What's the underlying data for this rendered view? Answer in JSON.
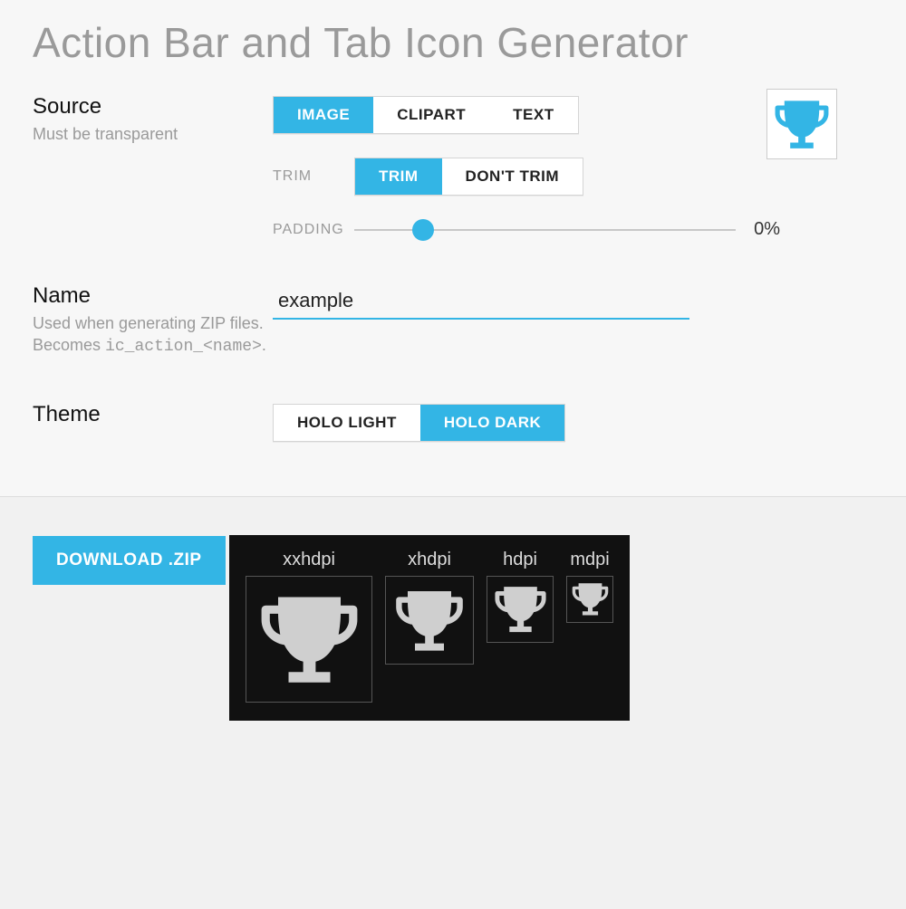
{
  "page": {
    "title": "Action Bar and Tab Icon Generator"
  },
  "source": {
    "label": "Source",
    "sub": "Must be transparent",
    "tabs": {
      "image": "IMAGE",
      "clipart": "CLIPART",
      "text": "TEXT"
    },
    "active": "image",
    "trim": {
      "label": "TRIM",
      "options": {
        "trim": "TRIM",
        "dont_trim": "DON'T TRIM"
      },
      "active": "trim"
    },
    "padding": {
      "label": "PADDING",
      "value_pct": 0,
      "display": "0%",
      "slider_position_pct": 18
    }
  },
  "name": {
    "label": "Name",
    "sub_line1": "Used when generating ZIP files. Becomes",
    "sub_line2": "ic_action_<name>",
    "sub_line3": ".",
    "value": "example"
  },
  "theme": {
    "label": "Theme",
    "options": {
      "light": "HOLO LIGHT",
      "dark": "HOLO DARK"
    },
    "active": "dark"
  },
  "download": {
    "label": "DOWNLOAD .ZIP"
  },
  "densities": [
    {
      "id": "xxhdpi",
      "label": "xxhdpi",
      "size": 140
    },
    {
      "id": "xhdpi",
      "label": "xhdpi",
      "size": 98
    },
    {
      "id": "hdpi",
      "label": "hdpi",
      "size": 74
    },
    {
      "id": "mdpi",
      "label": "mdpi",
      "size": 52
    }
  ],
  "colors": {
    "accent": "#33b5e5"
  }
}
